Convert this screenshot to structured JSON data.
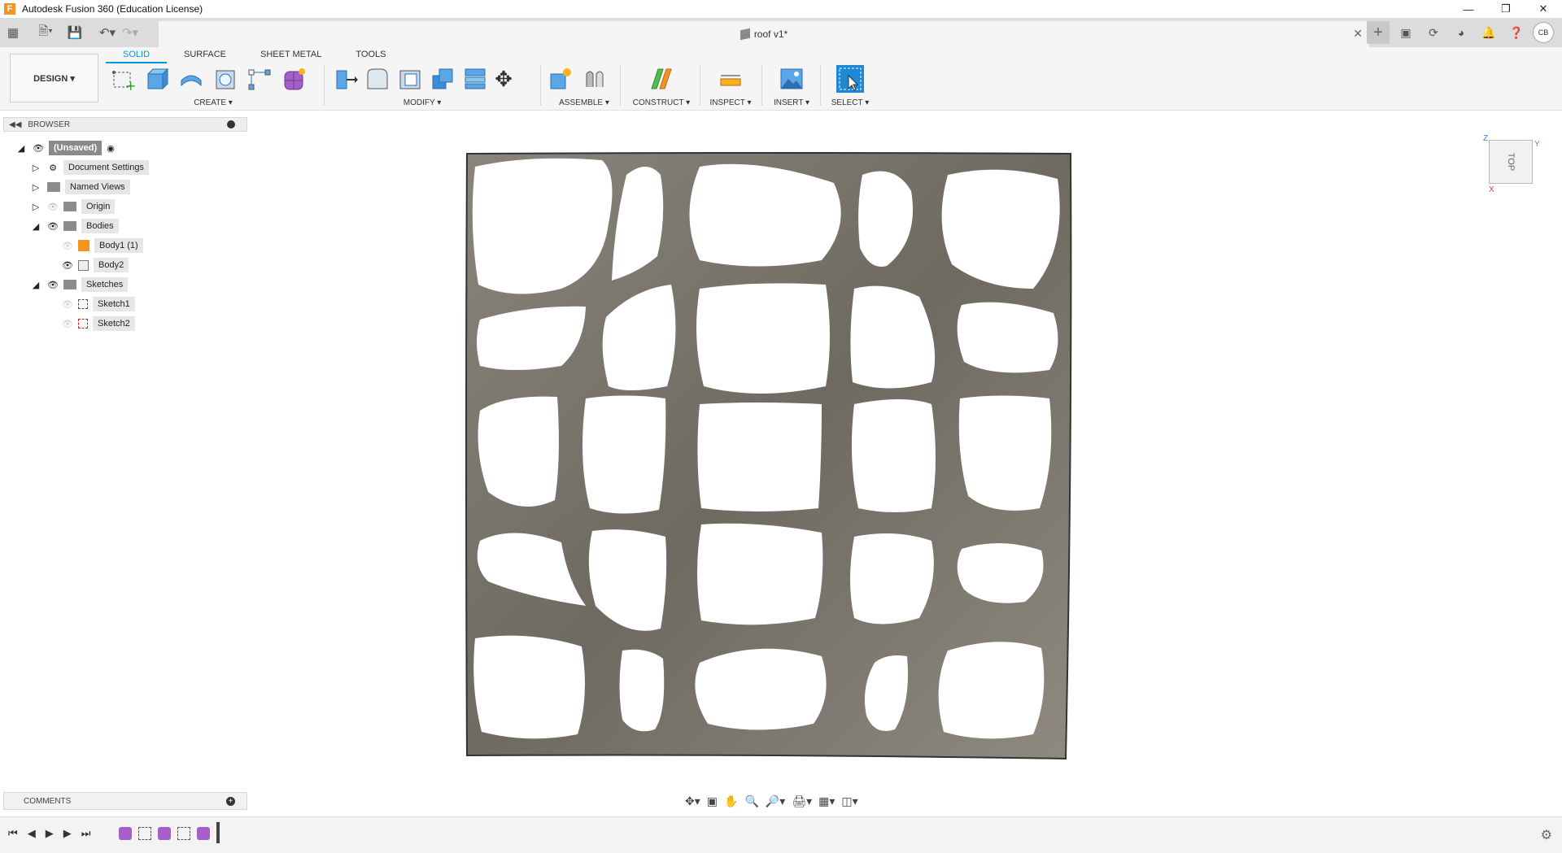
{
  "window": {
    "title": "Autodesk Fusion 360 (Education License)",
    "logo": "F"
  },
  "document_tab": {
    "title": "roof v1*"
  },
  "user": {
    "initials": "CB"
  },
  "workspace_tabs": [
    "SOLID",
    "SURFACE",
    "SHEET METAL",
    "TOOLS"
  ],
  "design_button": "DESIGN ▾",
  "groups": {
    "create": "CREATE ▾",
    "modify": "MODIFY ▾",
    "assemble": "ASSEMBLE ▾",
    "construct": "CONSTRUCT ▾",
    "inspect": "INSPECT ▾",
    "insert": "INSERT ▾",
    "select": "SELECT ▾"
  },
  "browser": {
    "header": "BROWSER",
    "root": "(Unsaved)",
    "document_settings": "Document Settings",
    "named_views": "Named Views",
    "origin": "Origin",
    "bodies": "Bodies",
    "body1": "Body1 (1)",
    "body2": "Body2",
    "sketches": "Sketches",
    "sketch1": "Sketch1",
    "sketch2": "Sketch2"
  },
  "comments": {
    "label": "COMMENTS"
  },
  "viewcube": {
    "face": "TOP",
    "axis_z": "Z",
    "axis_y": "Y",
    "axis_x": "X"
  },
  "colors": {
    "accent": "#0696d7",
    "mesh": "#7a756c",
    "timeline_feature": "#a55fc8"
  }
}
